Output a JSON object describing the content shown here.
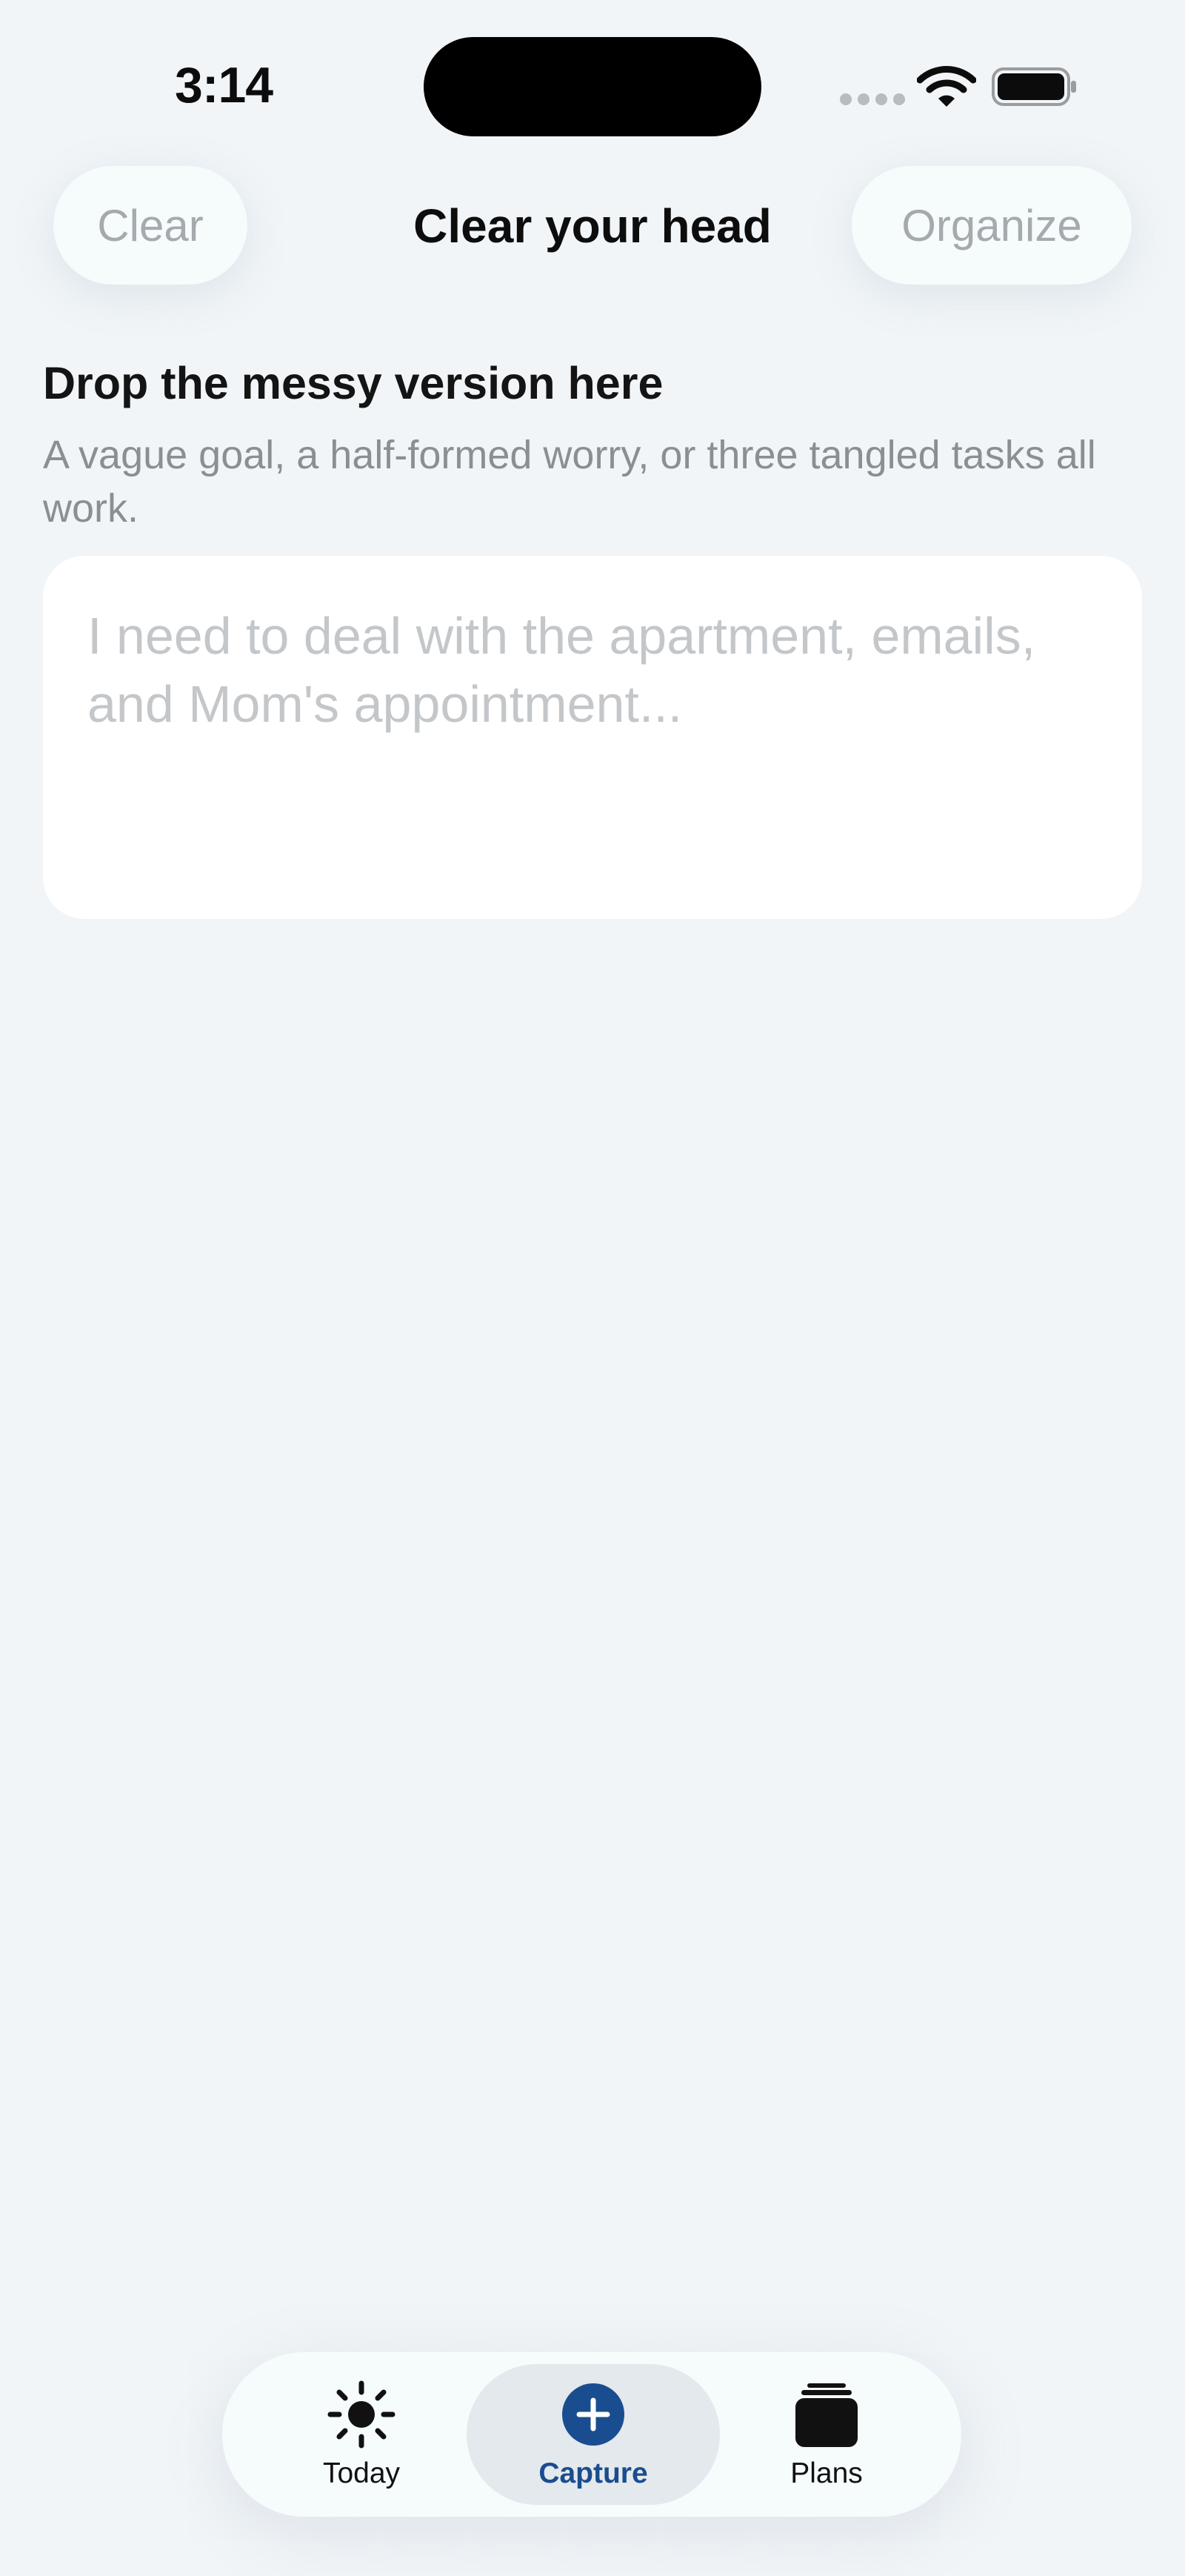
{
  "status_bar": {
    "time": "3:14",
    "icons": [
      "signal-icon",
      "wifi-icon",
      "battery-icon"
    ]
  },
  "header": {
    "title": "Clear your head",
    "clear_label": "Clear",
    "organize_label": "Organize"
  },
  "capture": {
    "heading": "Drop the messy version here",
    "subtitle": "A vague goal, a half-formed worry, or three tangled tasks all work.",
    "input_value": "",
    "placeholder": "I need to deal with the apartment, emails, and Mom's appointment..."
  },
  "tabs": [
    {
      "label": "Today",
      "icon": "sun-icon",
      "selected": false
    },
    {
      "label": "Capture",
      "icon": "plus-circle-icon",
      "selected": true
    },
    {
      "label": "Plans",
      "icon": "stack-icon",
      "selected": false
    }
  ],
  "colors": {
    "background": "#f1f5f8",
    "accent": "#1a4d8f",
    "disabled_text": "#a6aaae",
    "placeholder_text": "#c4c7ca",
    "secondary_text": "#8b8f93"
  }
}
